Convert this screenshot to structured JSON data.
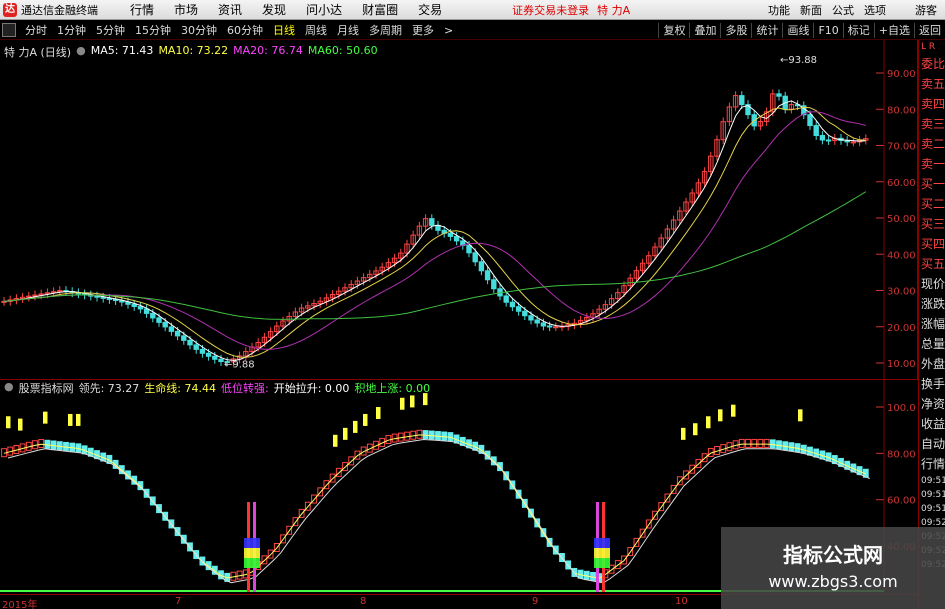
{
  "menubar": {
    "logo": "达",
    "app_title": "通达信金融终端",
    "items": [
      "行情",
      "市场",
      "资讯",
      "发现",
      "问小达",
      "财富圈",
      "交易"
    ],
    "status_text": "证券交易未登录",
    "stock_name": "特 力A",
    "right_items": [
      "功能",
      "新面",
      "公式",
      "选项"
    ],
    "guest": "游客"
  },
  "toolbar": {
    "periods": [
      "分时",
      "1分钟",
      "5分钟",
      "15分钟",
      "30分钟",
      "60分钟",
      "日线",
      "周线",
      "月线",
      "多周期",
      "更多"
    ],
    "active_period": "日线",
    "right_items": [
      "复权",
      "叠加",
      "多股",
      "统计",
      "画线",
      "F10",
      "标记",
      "+自选",
      "返回"
    ]
  },
  "main_chart": {
    "stock_label": "特 力A (日线)",
    "ma": [
      {
        "label": "MA5: 71.43",
        "color": "#ffffff"
      },
      {
        "label": "MA10: 73.22",
        "color": "#ffff44"
      },
      {
        "label": "MA20: 76.74",
        "color": "#ff44ff"
      },
      {
        "label": "MA60: 50.60",
        "color": "#44ff44"
      }
    ],
    "price_axis": [
      "90.00",
      "80.00",
      "70.00",
      "60.00",
      "50.00",
      "40.00",
      "30.00",
      "20.00",
      "10.00"
    ],
    "high_label": "93.88",
    "low_label": "9.88",
    "ma_colors": {
      "ma5": "#ffffff",
      "ma10": "#e6d24a",
      "ma20": "#b030b0",
      "ma60": "#40c040"
    },
    "up_color": "#ff4444",
    "down_color": "#44dddd"
  },
  "sub_chart": {
    "indicator": "股票指标网",
    "items": [
      {
        "label": "领先: 73.27",
        "color": "#dddddd"
      },
      {
        "label": "生命线: 74.44",
        "color": "#ffff44"
      },
      {
        "label": "低位转强: ",
        "color": "#ff44ff"
      },
      {
        "label": "开始拉升: 0.00",
        "color": "#ffffff"
      },
      {
        "label": "积地上涨: 0.00",
        "color": "#44ff44"
      }
    ],
    "axis": [
      "100.0",
      "80.00",
      "60.00",
      "40.00"
    ]
  },
  "side_panel": {
    "top": "L R",
    "items": [
      "委比",
      "卖五",
      "卖四",
      "卖三",
      "卖二",
      "卖一",
      "买一",
      "买二",
      "买三",
      "买四",
      "买五",
      "现价",
      "涨跌",
      "涨幅",
      "总量",
      "外盘",
      "换手",
      "净资",
      "收益",
      "自动",
      "行情",
      "09:51",
      "09:51",
      "09:51",
      "09:52",
      "09:52",
      "09:52",
      "09:52"
    ]
  },
  "date_bar": [
    "2015年",
    "7",
    "8",
    "9",
    "10"
  ],
  "watermark": {
    "title": "指标公式网",
    "url": "www.zbgs3.com"
  }
}
